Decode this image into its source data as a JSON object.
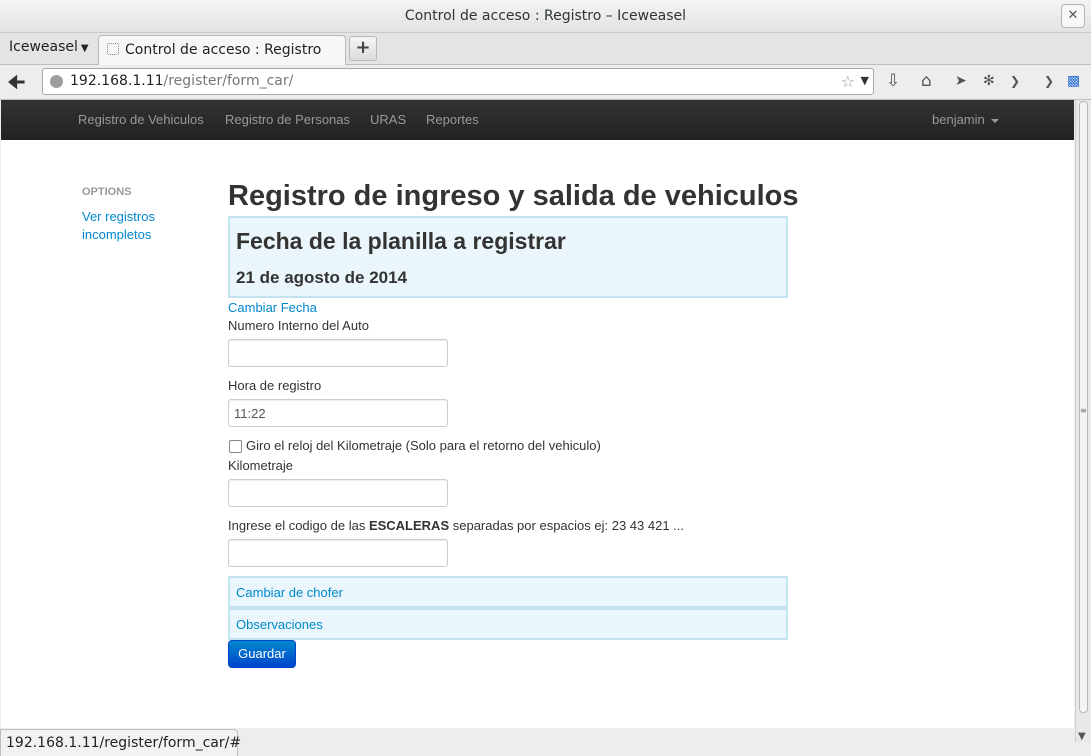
{
  "window": {
    "title": "Control de acceso : Registro – Iceweasel",
    "close_glyph": "✕"
  },
  "browser": {
    "menu_label": "Iceweasel",
    "tab_label": "Control de acceso : Registro",
    "new_tab_glyph": "+",
    "url_host": "192.168.1.11",
    "url_path": "/register/form_car/",
    "status_url": "192.168.1.11/register/form_car/#"
  },
  "topnav": {
    "items": [
      "Registro de Vehiculos",
      "Registro de Personas",
      "URAS",
      "Reportes"
    ],
    "user": "benjamin"
  },
  "sidebar": {
    "header": "OPTIONS",
    "link": "Ver registros incompletos"
  },
  "main": {
    "title": "Registro de ingreso y salida de vehiculos",
    "date_heading": "Fecha de la planilla a registrar",
    "date_value": "21 de agosto de 2014",
    "change_date": "Cambiar Fecha",
    "numero_label": "Numero Interno del Auto",
    "numero_value": "",
    "hora_label": "Hora de registro",
    "hora_value": "11:22",
    "checkbox_label": "Giro el reloj del Kilometraje (Solo para el retorno del vehiculo)",
    "checkbox_checked": false,
    "km_label": "Kilometraje",
    "km_value": "",
    "escaleras_pre": "Ingrese el codigo de las ",
    "escaleras_bold": "ESCALERAS",
    "escaleras_post": " separadas por espacios ej: 23 43 421 ...",
    "escaleras_value": "",
    "panel_chofer": "Cambiar de chofer",
    "panel_obs": "Observaciones",
    "submit": "Guardar"
  },
  "colors": {
    "link": "#0088cc",
    "navbar": "#222222",
    "well_bg": "#eaf6fb",
    "button": "#0055cc"
  }
}
